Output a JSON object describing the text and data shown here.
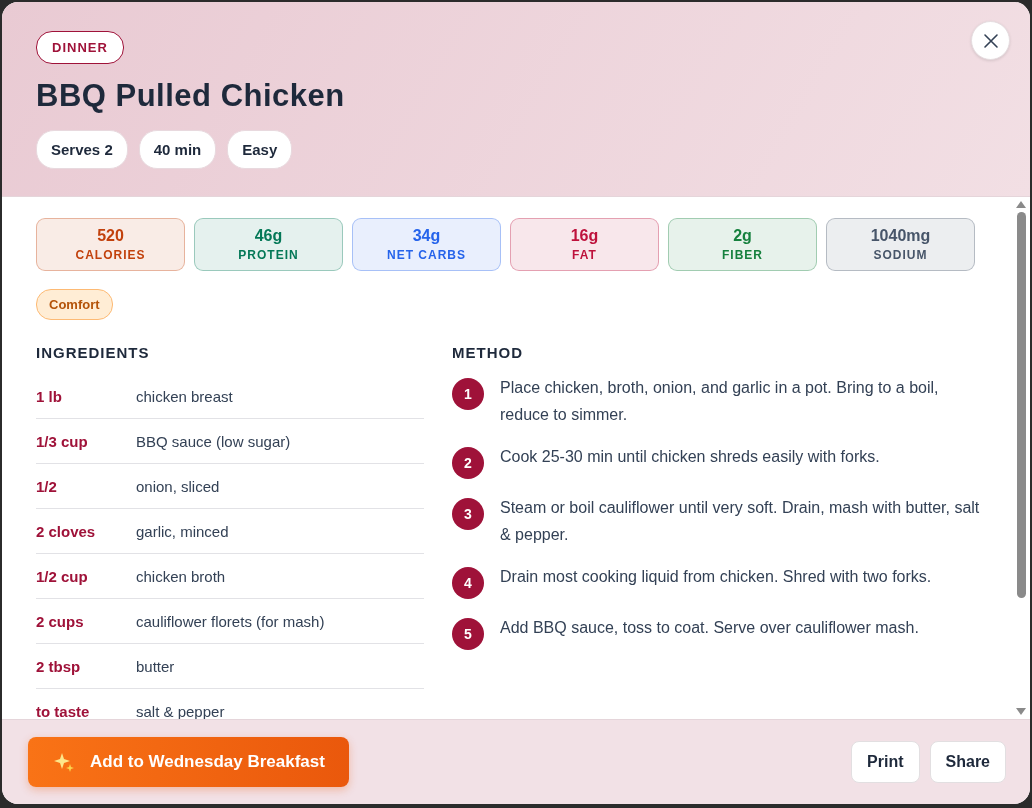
{
  "meal_type": "DINNER",
  "title": "BBQ Pulled Chicken",
  "meta": [
    "Serves 2",
    "40 min",
    "Easy"
  ],
  "nutrition": [
    {
      "value": "520",
      "label": "CALORIES",
      "color": "#c2410c"
    },
    {
      "value": "46g",
      "label": "PROTEIN",
      "color": "#047857"
    },
    {
      "value": "34g",
      "label": "NET CARBS",
      "color": "#2563eb"
    },
    {
      "value": "16g",
      "label": "FAT",
      "color": "#be123c"
    },
    {
      "value": "2g",
      "label": "FIBER",
      "color": "#15803d"
    },
    {
      "value": "1040mg",
      "label": "SODIUM",
      "color": "#475569"
    }
  ],
  "tags": [
    "Comfort"
  ],
  "ingredients": {
    "heading": "INGREDIENTS",
    "items": [
      {
        "amount": "1 lb",
        "name": "chicken breast"
      },
      {
        "amount": "1/3 cup",
        "name": "BBQ sauce (low sugar)"
      },
      {
        "amount": "1/2",
        "name": "onion, sliced"
      },
      {
        "amount": "2 cloves",
        "name": "garlic, minced"
      },
      {
        "amount": "1/2 cup",
        "name": "chicken broth"
      },
      {
        "amount": "2 cups",
        "name": "cauliflower florets (for mash)"
      },
      {
        "amount": "2 tbsp",
        "name": "butter"
      },
      {
        "amount": "to taste",
        "name": "salt & pepper"
      }
    ]
  },
  "method": {
    "heading": "METHOD",
    "steps": [
      {
        "number": "1",
        "text": "Place chicken, broth, onion, and garlic in a pot. Bring to a boil, reduce to simmer."
      },
      {
        "number": "2",
        "text": "Cook 25-30 min until chicken shreds easily with forks."
      },
      {
        "number": "3",
        "text": "Steam or boil cauliflower until very soft. Drain, mash with butter, salt & pepper."
      },
      {
        "number": "4",
        "text": "Drain most cooking liquid from chicken. Shred with two forks."
      },
      {
        "number": "5",
        "text": "Add BBQ sauce, toss to coat. Serve over cauliflower mash."
      }
    ]
  },
  "footer": {
    "primary": "Add to Wednesday Breakfast",
    "secondary": [
      "Print",
      "Share"
    ]
  }
}
